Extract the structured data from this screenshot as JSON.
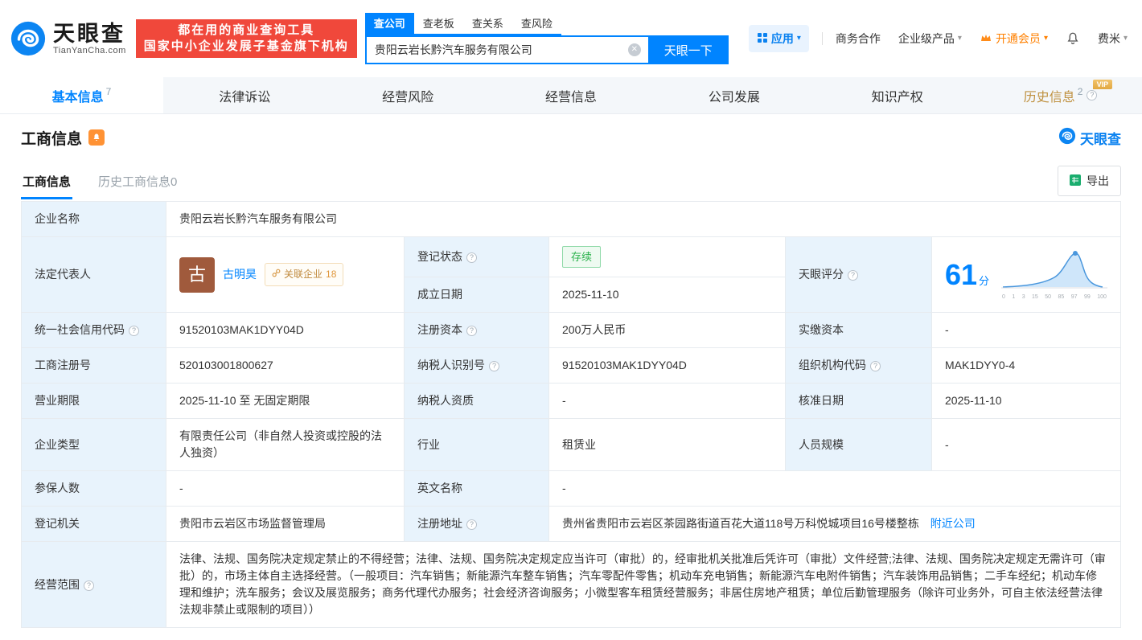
{
  "colors": {
    "primary": "#0084ff",
    "banner_red": "#f0483b",
    "vip_orange": "#ff8000",
    "status_green": "#2ab24c",
    "label_cell_bg": "#e8f3fc",
    "history_gold": "#bf9140"
  },
  "icons": {
    "question_mark": "?",
    "caret": "▾",
    "clear": "✕"
  },
  "header": {
    "logo": {
      "brand": "天眼查",
      "domain": "TianYanCha.com"
    },
    "banner": {
      "line1": "都在用的商业查询工具",
      "line2": "国家中小企业发展子基金旗下机构"
    },
    "search": {
      "tabs": [
        {
          "label": "查公司"
        },
        {
          "label": "查老板"
        },
        {
          "label": "查关系"
        },
        {
          "label": "查风险"
        }
      ],
      "value": "贵阳云岩长黔汽车服务有限公司",
      "button": "天眼一下"
    },
    "nav": {
      "apps": "应用",
      "cooperation": "商务合作",
      "enterprise": "企业级产品",
      "vip": "开通会员",
      "user": "费米"
    }
  },
  "tabs": {
    "items": [
      {
        "label": "基本信息",
        "count": "7"
      },
      {
        "label": "法律诉讼",
        "count": ""
      },
      {
        "label": "经营风险",
        "count": ""
      },
      {
        "label": "经营信息",
        "count": ""
      },
      {
        "label": "公司发展",
        "count": ""
      },
      {
        "label": "知识产权",
        "count": ""
      },
      {
        "label": "历史信息",
        "count": "2",
        "vip": "VIP"
      }
    ]
  },
  "section": {
    "title": "工商信息",
    "brand": "天眼查",
    "subtabs": [
      {
        "label": "工商信息"
      },
      {
        "label": "历史工商信息0"
      }
    ],
    "export": "导出"
  },
  "biz": {
    "company_name_label": "企业名称",
    "company_name": "贵阳云岩长黔汽车服务有限公司",
    "legal_rep_label": "法定代表人",
    "legal_rep_avatar": "古",
    "legal_rep_name": "古明昊",
    "related_label": "关联企业",
    "related_count": "18",
    "reg_status_label": "登记状态",
    "reg_status": "存续",
    "establish_date_label": "成立日期",
    "establish_date": "2025-11-10",
    "score_label": "天眼评分",
    "score_value": "61",
    "score_unit": "分",
    "score_axis": [
      "0",
      "1",
      "3",
      "15",
      "50",
      "85",
      "97",
      "99",
      "100"
    ],
    "credit_code_label": "统一社会信用代码",
    "credit_code": "91520103MAK1DYY04D",
    "reg_capital_label": "注册资本",
    "reg_capital": "200万人民币",
    "paid_capital_label": "实缴资本",
    "paid_capital": "-",
    "reg_number_label": "工商注册号",
    "reg_number": "520103001800627",
    "taxpayer_id_label": "纳税人识别号",
    "taxpayer_id": "91520103MAK1DYY04D",
    "org_code_label": "组织机构代码",
    "org_code": "MAK1DYY0-4",
    "business_term_label": "营业期限",
    "business_term": "2025-11-10 至 无固定期限",
    "taxpayer_quality_label": "纳税人资质",
    "taxpayer_quality": "-",
    "approve_date_label": "核准日期",
    "approve_date": "2025-11-10",
    "company_type_label": "企业类型",
    "company_type": "有限责任公司（非自然人投资或控股的法人独资）",
    "industry_label": "行业",
    "industry": "租赁业",
    "staff_size_label": "人员规模",
    "staff_size": "-",
    "insured_label": "参保人数",
    "insured": "-",
    "english_name_label": "英文名称",
    "english_name": "-",
    "reg_authority_label": "登记机关",
    "reg_authority": "贵阳市云岩区市场监督管理局",
    "address_label": "注册地址",
    "address": "贵州省贵阳市云岩区茶园路街道百花大道118号万科悦城项目16号楼整栋",
    "nearby_link": "附近公司",
    "business_scope_label": "经营范围",
    "business_scope": "法律、法规、国务院决定规定禁止的不得经营；法律、法规、国务院决定规定应当许可（审批）的，经审批机关批准后凭许可（审批）文件经营;法律、法规、国务院决定规定无需许可（审批）的，市场主体自主选择经营。（一般项目：汽车销售；新能源汽车整车销售；汽车零配件零售；机动车充电销售；新能源汽车电附件销售；汽车装饰用品销售；二手车经纪；机动车修理和维护；洗车服务；会议及展览服务；商务代理代办服务；社会经济咨询服务；小微型客车租赁经营服务；非居住房地产租赁；单位后勤管理服务（除许可业务外，可自主依法经营法律法规非禁止或限制的项目））"
  }
}
